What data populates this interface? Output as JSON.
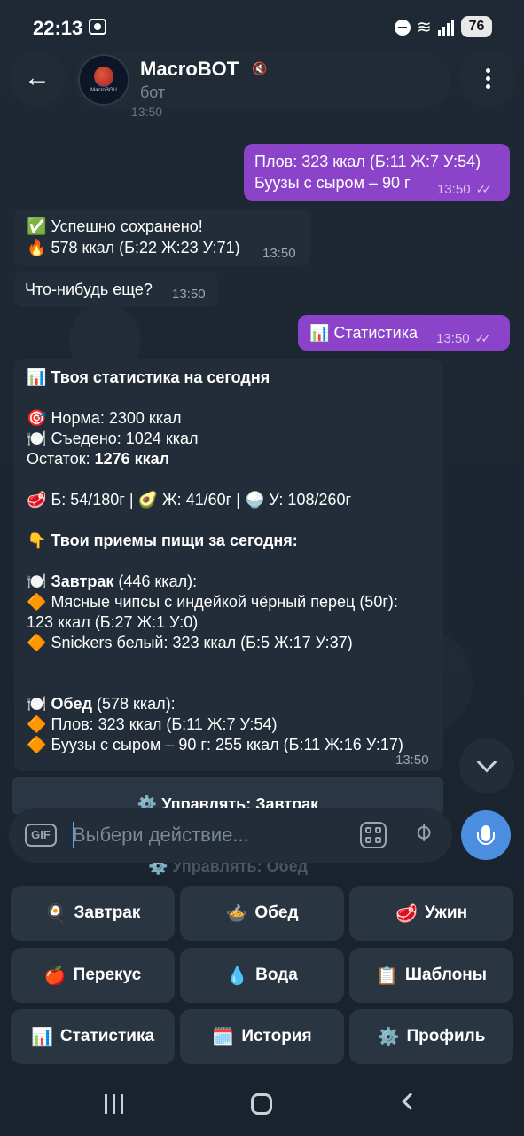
{
  "status_bar": {
    "time": "22:13",
    "battery": "76"
  },
  "header": {
    "title": "MacroBOT",
    "subtitle": "бот",
    "avatar_caption": "MacroBGU",
    "partial_time": "13:50"
  },
  "messages": {
    "out1": {
      "line1": "Плов: 323 ккал (Б:11 Ж:7 У:54)",
      "line2": "Буузы с сыром – 90 г",
      "time": "13:50"
    },
    "in1": {
      "line1_emoji": "✅",
      "line1": "Успешно сохранено!",
      "line2_emoji": "🔥",
      "line2": "578 ккал (Б:22 Ж:23 У:71)",
      "time": "13:50"
    },
    "in2": {
      "text": "Что-нибудь еще?",
      "time": "13:50"
    },
    "out2": {
      "emoji": "📊",
      "text": "Статистика",
      "time": "13:50"
    },
    "stats": {
      "title_emoji": "📊",
      "title": "Твоя статистика на сегодня",
      "norm_emoji": "🎯",
      "norm": "Норма: 2300 ккал",
      "eaten_emoji": "🍽️",
      "eaten": "Съедено: 1024 ккал",
      "rest_label": "Остаток: ",
      "rest_value": "1276 ккал",
      "protein_emoji": "🥩",
      "protein": "Б: 54/180г",
      "fat_emoji": "🥑",
      "fat": "Ж: 41/60г",
      "carb_emoji": "🍚",
      "carb": "У: 108/260г",
      "meals_emoji": "👇",
      "meals_title": "Твои приемы пищи за сегодня:",
      "breakfast_emoji": "🍽️",
      "breakfast_name": "Завтрак",
      "breakfast_kcal": " (446 ккал):",
      "b_item1_a": "Мясные чипсы с индейкой чёрный перец (50г):",
      "b_item1_b": "123 ккал (Б:27 Ж:1 У:0)",
      "b_item2": "Snickers белый: 323 ккал (Б:5 Ж:17 У:37)",
      "lunch_emoji": "🍽️",
      "lunch_name": "Обед",
      "lunch_kcal": " (578 ккал):",
      "l_item1": "Плов: 323 ккал (Б:11 Ж:7 У:54)",
      "l_item2": "Буузы с сыром – 90 г: 255 ккал (Б:11 Ж:16 У:17)",
      "bullet": "🔶",
      "time": "13:50"
    }
  },
  "inline_keyboard": {
    "manage_breakfast": "⚙️ Управлять: Завтрак",
    "manage_lunch": "⚙️ Управлять: Обед"
  },
  "input": {
    "gif_label": "GIF",
    "placeholder": "Выбери действие..."
  },
  "reply_keyboard": [
    {
      "emoji": "🍳",
      "label": "Завтрак"
    },
    {
      "emoji": "🍲",
      "label": "Обед"
    },
    {
      "emoji": "🥩",
      "label": "Ужин"
    },
    {
      "emoji": "🍎",
      "label": "Перекус"
    },
    {
      "emoji": "💧",
      "label": "Вода"
    },
    {
      "emoji": "📋",
      "label": "Шаблоны"
    },
    {
      "emoji": "📊",
      "label": "Статистика"
    },
    {
      "emoji": "🗓️",
      "label": "История"
    },
    {
      "emoji": "⚙️",
      "label": "Профиль"
    }
  ],
  "icons": {
    "back": "back-arrow-icon",
    "menu": "more-vertical-icon",
    "mute": "muted-speaker-icon",
    "scroll": "chevron-down-icon",
    "mic": "microphone-icon",
    "attach": "paperclip-icon",
    "kb": "keyboard-grid-icon"
  },
  "colors": {
    "outgoing_bubble": "#8b44c9",
    "incoming_bubble": "#222d39",
    "mic_button": "#4c8fe0",
    "background": "#1b2531"
  }
}
